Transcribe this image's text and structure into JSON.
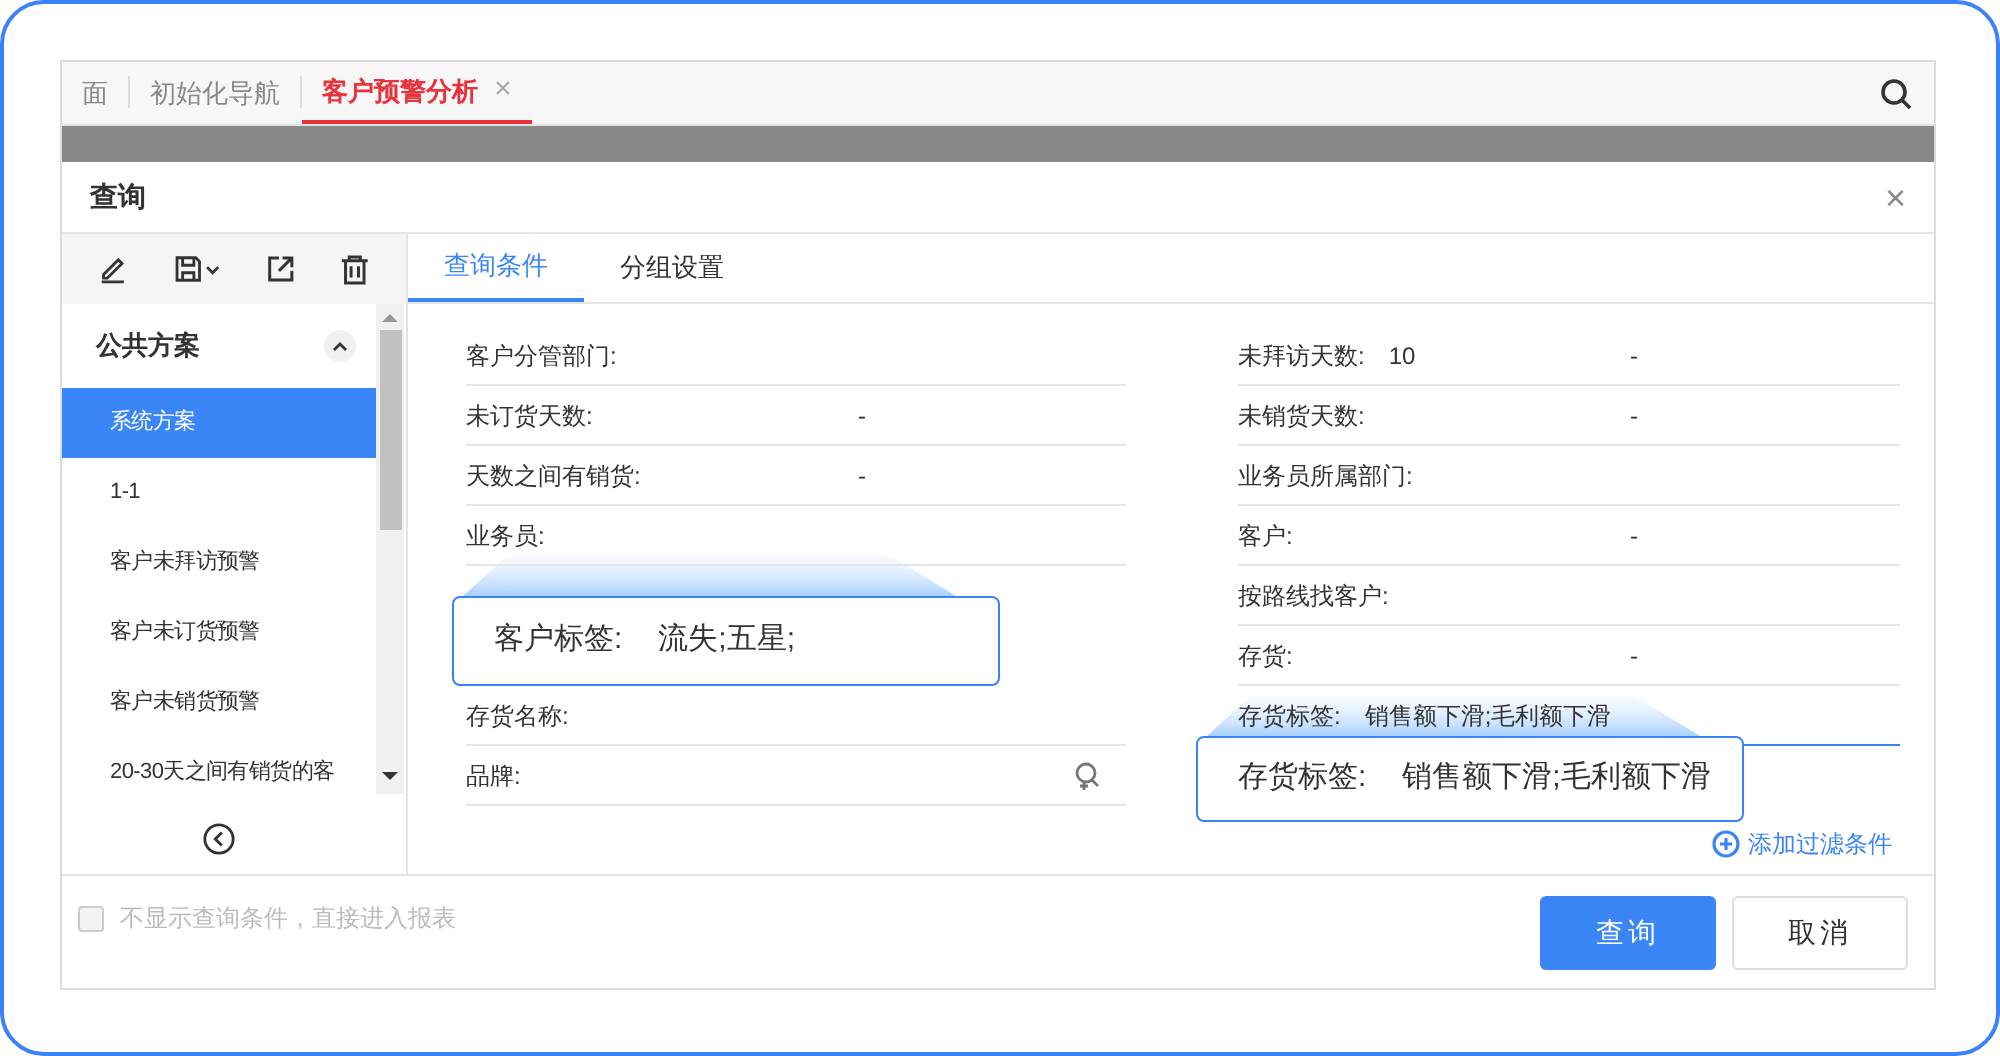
{
  "app_tabs": [
    {
      "label": "面",
      "selected": false
    },
    {
      "label": "初始化导航",
      "selected": false
    },
    {
      "label": "客户预警分析",
      "selected": true,
      "close": "×"
    }
  ],
  "dialog": {
    "title": "查询",
    "close": "×"
  },
  "tabs": [
    {
      "label": "查询条件",
      "selected": true
    },
    {
      "label": "分组设置",
      "selected": false
    }
  ],
  "sidebar": {
    "header": "公共方案",
    "expanded": true,
    "items": [
      {
        "label": "系统方案",
        "selected": true
      },
      {
        "label": "1-1",
        "selected": false
      },
      {
        "label": "客户未拜访预警",
        "selected": false
      },
      {
        "label": "客户未订货预警",
        "selected": false
      },
      {
        "label": "客户未销货预警",
        "selected": false
      },
      {
        "label": "20-30天之间有销货的客",
        "selected": false
      }
    ]
  },
  "left_fields": [
    {
      "kind": "field",
      "label": "客户分管部门:"
    },
    {
      "kind": "field",
      "label": "未订货天数:",
      "separator": "-"
    },
    {
      "kind": "field",
      "label": "天数之间有销货:",
      "separator": "-"
    },
    {
      "kind": "field",
      "label": "业务员:"
    },
    {
      "kind": "callout",
      "label": "客户标签:",
      "value": "流失;五星;"
    },
    {
      "kind": "field",
      "label": "存货名称:"
    },
    {
      "kind": "lookup",
      "label": "品牌:"
    }
  ],
  "right_fields": [
    {
      "kind": "field",
      "label": "未拜访天数:",
      "value": "10",
      "separator": "-"
    },
    {
      "kind": "field",
      "label": "未销货天数:",
      "separator": "-"
    },
    {
      "kind": "field",
      "label": "业务员所属部门:"
    },
    {
      "kind": "field",
      "label": "客户:",
      "separator": "-"
    },
    {
      "kind": "field",
      "label": "按路线找客户:"
    },
    {
      "kind": "field",
      "label": "存货:",
      "separator": "-"
    },
    {
      "kind": "focused",
      "label": "存货标签:",
      "value": "销售额下滑;毛利额下滑"
    },
    {
      "kind": "callout",
      "label": "存货标签:",
      "value": "销售额下滑;毛利额下滑"
    }
  ],
  "add_filter": "添加过滤条件",
  "footer": {
    "checkbox": {
      "label": "不显示查询条件，直接进入报表",
      "checked": false
    },
    "buttons": [
      {
        "label": "查询",
        "kind": "primary"
      },
      {
        "label": "取消",
        "kind": "secondary"
      }
    ]
  }
}
